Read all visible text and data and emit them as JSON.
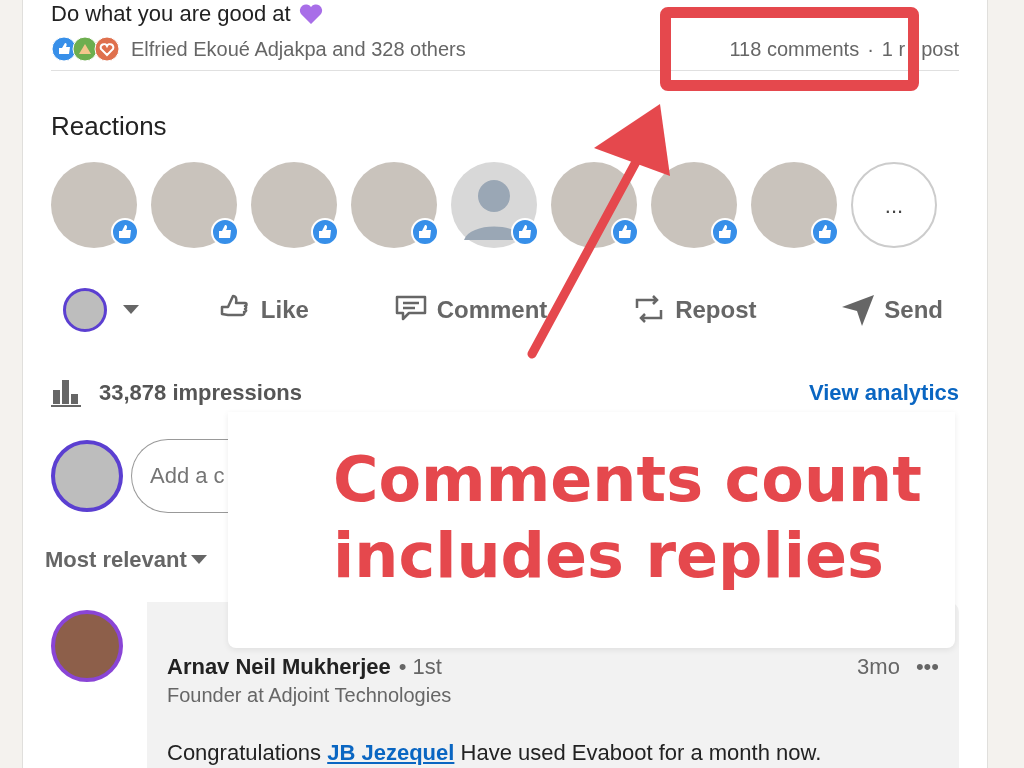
{
  "post": {
    "text": "Do what you are good at",
    "reactions_summary": "Elfried Ekoué Adjakpa and 328 others",
    "comments_count": "118 comments",
    "separator": "·",
    "reposts": "1 r",
    "reposts_tail": "post"
  },
  "reactions": {
    "title": "Reactions",
    "people": [
      {
        "kind": "photo"
      },
      {
        "kind": "photo"
      },
      {
        "kind": "photo"
      },
      {
        "kind": "photo"
      },
      {
        "kind": "default"
      },
      {
        "kind": "photo"
      },
      {
        "kind": "photo"
      },
      {
        "kind": "photo"
      },
      {
        "kind": "more",
        "label": "..."
      }
    ]
  },
  "actions": [
    {
      "kind": "like",
      "label": "Like"
    },
    {
      "kind": "comment",
      "label": "Comment"
    },
    {
      "kind": "repost",
      "label": "Repost"
    },
    {
      "kind": "send",
      "label": "Send"
    }
  ],
  "impressions": "33,878 impressions",
  "analytics_link": "View analytics",
  "comment_box": {
    "placeholder": "Add a c"
  },
  "sort": "Most relevant",
  "comments": [
    {
      "author": "Arnav Neil Mukherjee",
      "degree": "• 1st",
      "headline": "Founder at Adjoint Technologies",
      "time": "3mo",
      "more": "•••",
      "text_before": "Congratulations",
      "mention": "JB Jezequel",
      "text_after": "Have used Evaboot for a month now."
    }
  ],
  "annotation": {
    "text": "Comments count includes replies"
  }
}
